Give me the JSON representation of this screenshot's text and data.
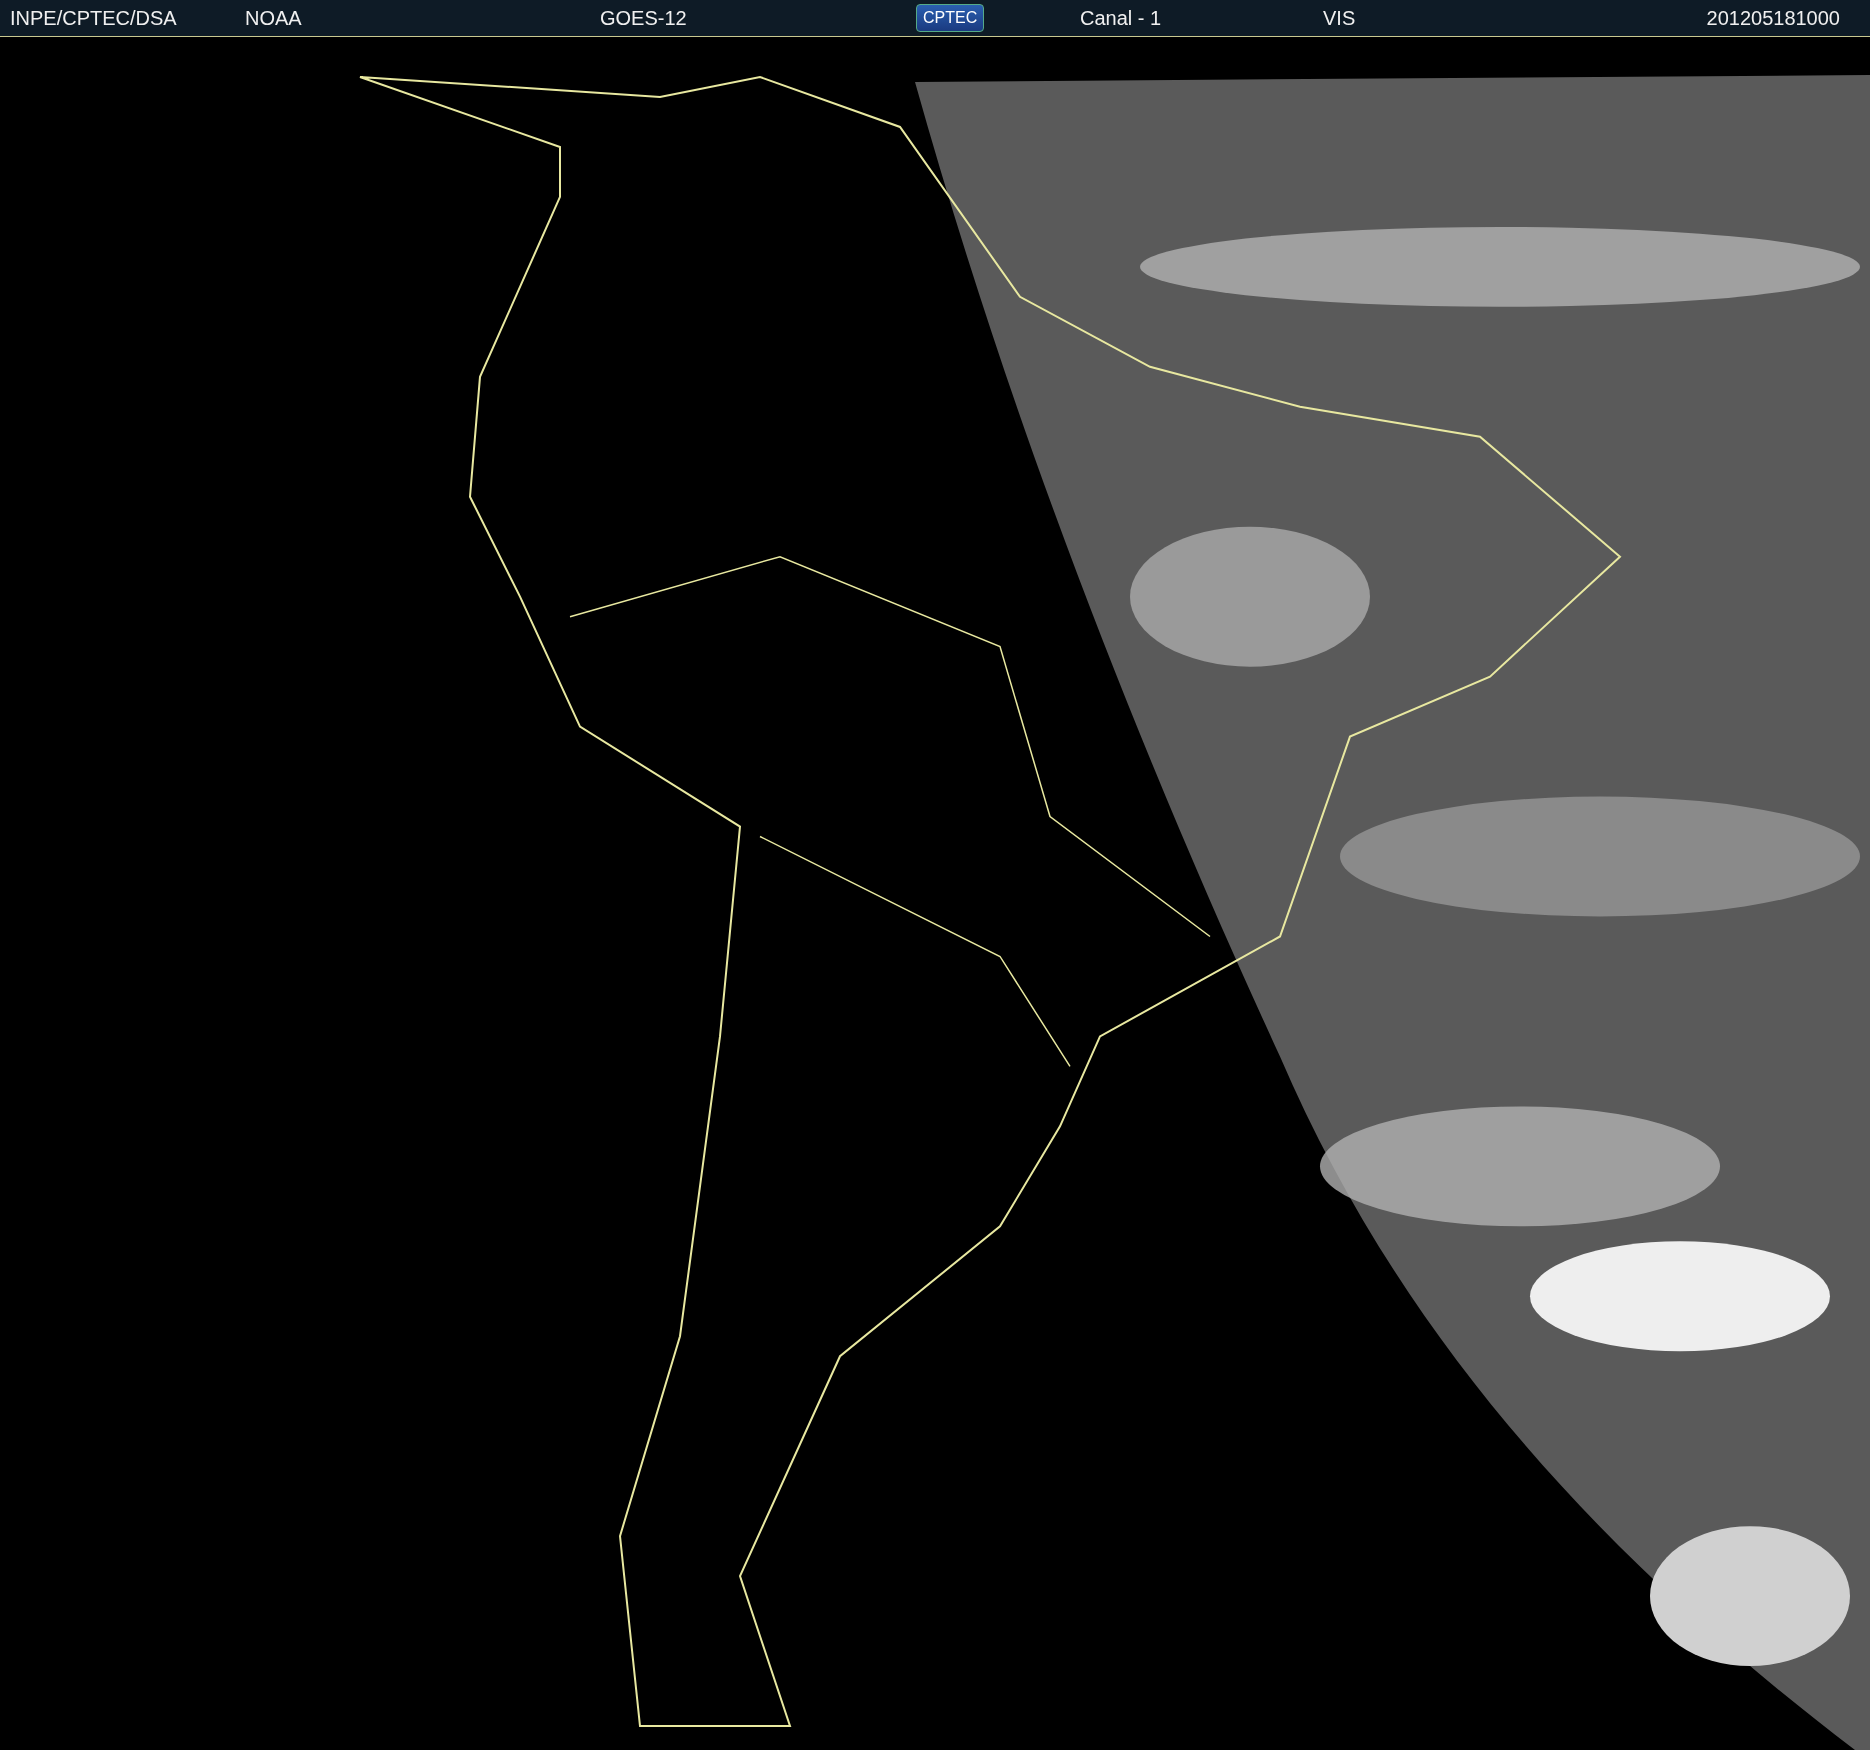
{
  "header": {
    "items": [
      {
        "kind": "text",
        "text": "INPE/CPTEC/DSA"
      },
      {
        "kind": "text",
        "text": "NOAA"
      },
      {
        "kind": "text",
        "text": "GOES-12"
      },
      {
        "kind": "logo",
        "text": "CPTEC"
      },
      {
        "kind": "text",
        "text": "Canal - 1"
      },
      {
        "kind": "text",
        "text": "VIS"
      },
      {
        "kind": "text",
        "text": "201205181000"
      }
    ]
  }
}
